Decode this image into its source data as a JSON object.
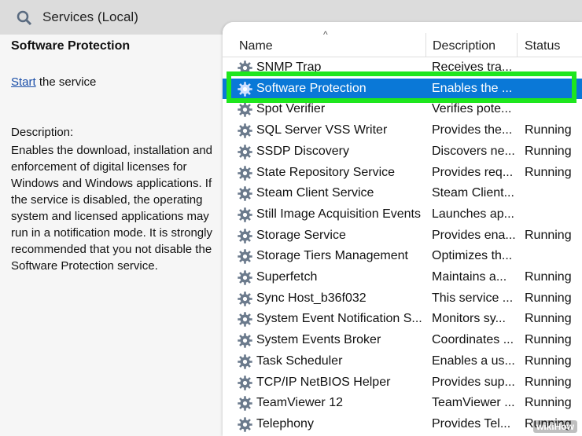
{
  "window": {
    "title": "Services (Local)"
  },
  "description_pane": {
    "service_name": "Software Protection",
    "start_link": "Start",
    "start_suffix": " the service",
    "description_label": "Description:",
    "description_text": "Enables the download, installation and enforcement of digital licenses for Windows and Windows applications. If the service is disabled, the operating system and licensed applications may run in a notification mode. It is strongly recommended that you not disable the Software Protection service."
  },
  "columns": {
    "name": "Name",
    "description": "Description",
    "status": "Status"
  },
  "rows": [
    {
      "name": "SNMP Trap",
      "description": "Receives tra...",
      "status": ""
    },
    {
      "name": "Software Protection",
      "description": "Enables the ...",
      "status": "",
      "selected": true
    },
    {
      "name": "Spot Verifier",
      "description": "Verifies pote...",
      "status": ""
    },
    {
      "name": "SQL Server VSS Writer",
      "description": "Provides the...",
      "status": "Running"
    },
    {
      "name": "SSDP Discovery",
      "description": "Discovers ne...",
      "status": "Running"
    },
    {
      "name": "State Repository Service",
      "description": "Provides req...",
      "status": "Running"
    },
    {
      "name": "Steam Client Service",
      "description": "Steam Client...",
      "status": ""
    },
    {
      "name": "Still Image Acquisition Events",
      "description": "Launches ap...",
      "status": ""
    },
    {
      "name": "Storage Service",
      "description": "Provides ena...",
      "status": "Running"
    },
    {
      "name": "Storage Tiers Management",
      "description": "Optimizes th...",
      "status": ""
    },
    {
      "name": "Superfetch",
      "description": "Maintains a...",
      "status": "Running"
    },
    {
      "name": "Sync Host_b36f032",
      "description": "This service ...",
      "status": "Running"
    },
    {
      "name": "System Event Notification S...",
      "description": "Monitors sy...",
      "status": "Running"
    },
    {
      "name": "System Events Broker",
      "description": "Coordinates ...",
      "status": "Running"
    },
    {
      "name": "Task Scheduler",
      "description": "Enables a us...",
      "status": "Running"
    },
    {
      "name": "TCP/IP NetBIOS Helper",
      "description": "Provides sup...",
      "status": "Running"
    },
    {
      "name": "TeamViewer 12",
      "description": "TeamViewer ...",
      "status": "Running"
    },
    {
      "name": "Telephony",
      "description": "Provides Tel...",
      "status": "Running"
    }
  ],
  "watermark": "wikiHow",
  "colors": {
    "selection": "#0a78d7",
    "highlight": "#1ee61e",
    "link": "#1a4ea8"
  }
}
